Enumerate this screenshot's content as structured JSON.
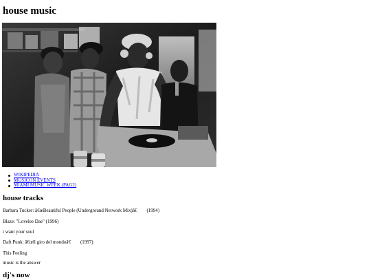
{
  "page": {
    "title": "house music"
  },
  "image": {
    "icon": "black-and-white-dj-photo"
  },
  "links": [
    {
      "label": "WIKIPEDIA"
    },
    {
      "label": "MUSICON EVENTS"
    },
    {
      "label": "MIAMI MUSIC WEEK (PAG2)"
    }
  ],
  "sections": {
    "tracks_heading": "house tracks",
    "djs_heading": "dj's now"
  },
  "tracks": [
    {
      "text": "Barbara Tucker: â€œBeautiful People (Underground Network Mix)â€",
      "year": "(1994)"
    },
    {
      "text": "Blaze: \"Lovelee Dae\" (1996)",
      "year": ""
    },
    {
      "text": "i want your soul",
      "year": ""
    },
    {
      "text": "Daft Punk: â€œll giro del mondoâ€",
      "year": "(1997)"
    },
    {
      "text": "This Feeling",
      "year": ""
    },
    {
      "text": "music is the answer",
      "year": ""
    }
  ],
  "colors": {
    "link": "#0000ee",
    "text": "#000000",
    "background": "#ffffff"
  }
}
